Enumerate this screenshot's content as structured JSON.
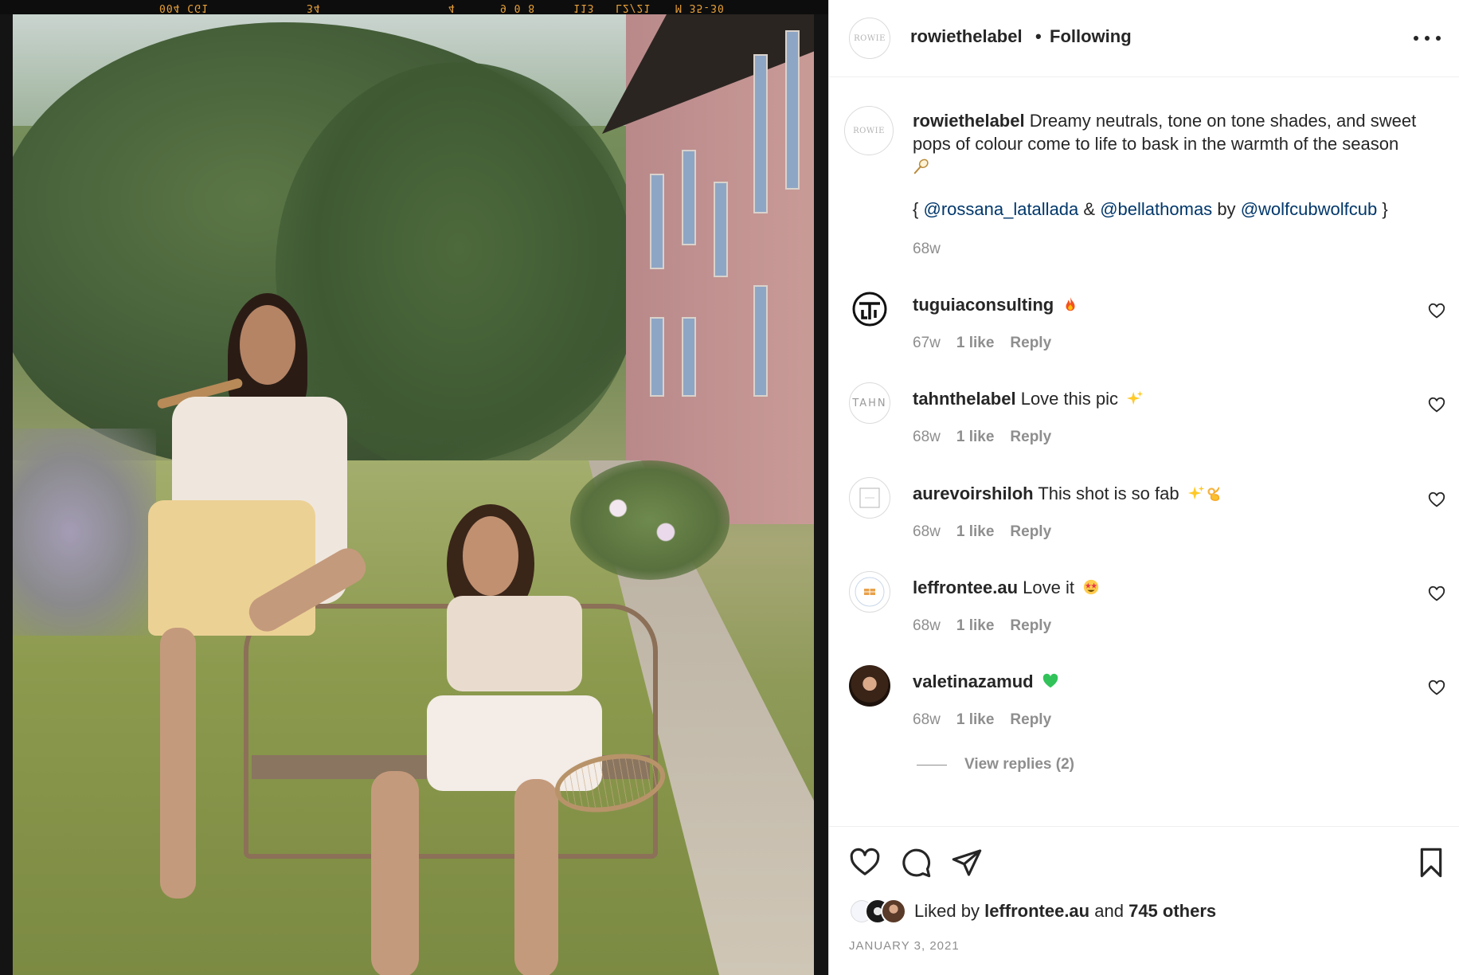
{
  "film_codes": [
    "004 CG1",
    "34",
    "4",
    "9 0 8",
    "113",
    "L2/21",
    "M 35-30"
  ],
  "post": {
    "username": "rowiethelabel",
    "separator": "•",
    "follow_state": "Following",
    "avatar_monogram": "ROWIE",
    "caption": "Dreamy neutrals, tone on tone shades, and sweet pops of colour come to life to bask in the warmth of the season",
    "tag_open": "{",
    "mention_1": "@rossana_latallada",
    "amp": "&",
    "mention_2": "@bellathomas",
    "by": "by",
    "mention_3": "@wolfcubwolfcub",
    "tag_close": "}",
    "caption_time": "68w"
  },
  "comments": [
    {
      "username": "tuguiaconsulting",
      "text": "",
      "emoji": "fire",
      "time": "67w",
      "likes": "1 like",
      "reply": "Reply",
      "avatar": "GTC-logo"
    },
    {
      "username": "tahnthelabel",
      "text": "Love this pic",
      "emoji": "sparkles",
      "time": "68w",
      "likes": "1 like",
      "reply": "Reply",
      "avatar": "TAHN"
    },
    {
      "username": "aurevoirshiloh",
      "text": "This shot is so fab",
      "emoji": "sparkles-ok-hand",
      "time": "68w",
      "likes": "1 like",
      "reply": "Reply",
      "avatar": "square-logo"
    },
    {
      "username": "leffrontee.au",
      "text": "Love it",
      "emoji": "star-struck",
      "time": "68w",
      "likes": "1 like",
      "reply": "Reply",
      "avatar": "leffrontee-logo"
    },
    {
      "username": "valetinazamud",
      "text": "",
      "emoji": "green-heart",
      "time": "68w",
      "likes": "1 like",
      "reply": "Reply",
      "avatar": "photo"
    }
  ],
  "view_replies": "View replies (2)",
  "likes": {
    "liked_by": "Liked by",
    "top_user": "leffrontee.au",
    "and": "and",
    "others": "745 others"
  },
  "date": "JANUARY 3, 2021",
  "colors": {
    "text": "#262626",
    "muted": "#8e8e8e",
    "mention": "#00376b",
    "border": "#dbdbdb"
  }
}
